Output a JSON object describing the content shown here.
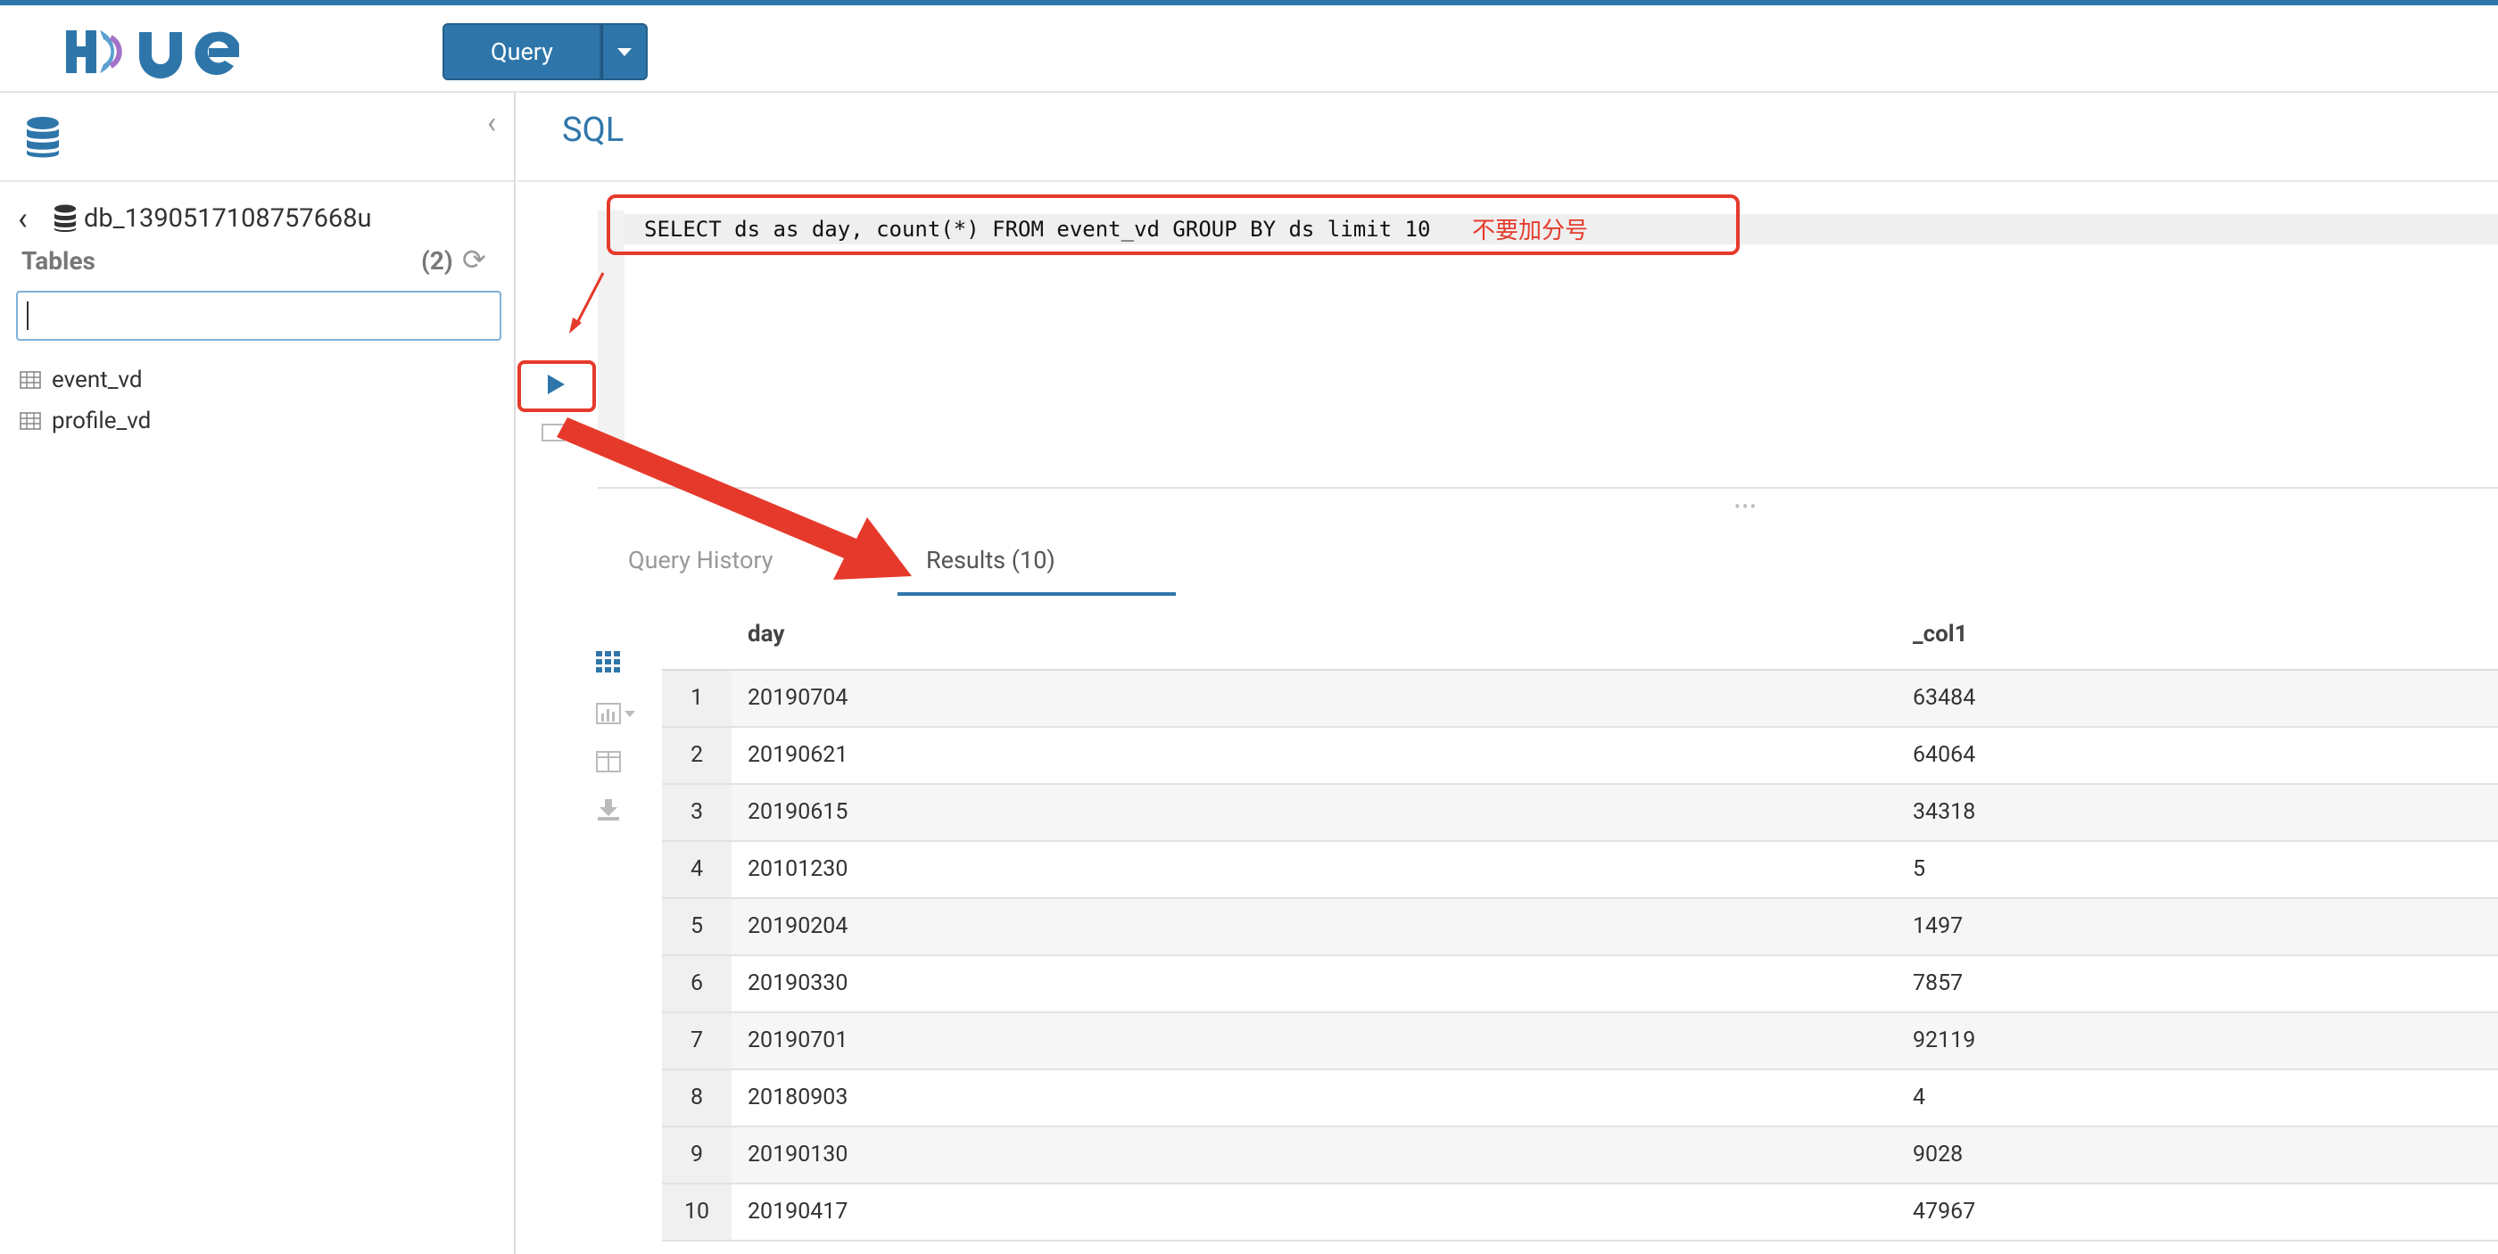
{
  "app": {
    "logo": "HUE",
    "query_button_label": "Query"
  },
  "sidebar": {
    "database_name": "db_1390517108757668u",
    "tables_label": "Tables",
    "tables_count": "(2)",
    "filter_value": "",
    "tables": [
      {
        "name": "event_vd"
      },
      {
        "name": "profile_vd"
      }
    ]
  },
  "editor": {
    "title": "SQL",
    "query": "SELECT ds as day, count(*) FROM event_vd GROUP BY ds limit 10",
    "annotation": "不要加分号"
  },
  "tabs": {
    "history": "Query History",
    "results": "Results (10)"
  },
  "results": {
    "columns": [
      "day",
      "_col1"
    ],
    "rows": [
      {
        "n": "1",
        "day": "20190704",
        "col1": "63484"
      },
      {
        "n": "2",
        "day": "20190621",
        "col1": "64064"
      },
      {
        "n": "3",
        "day": "20190615",
        "col1": "34318"
      },
      {
        "n": "4",
        "day": "20101230",
        "col1": "5"
      },
      {
        "n": "5",
        "day": "20190204",
        "col1": "1497"
      },
      {
        "n": "6",
        "day": "20190330",
        "col1": "7857"
      },
      {
        "n": "7",
        "day": "20190701",
        "col1": "92119"
      },
      {
        "n": "8",
        "day": "20180903",
        "col1": "4"
      },
      {
        "n": "9",
        "day": "20190130",
        "col1": "9028"
      },
      {
        "n": "10",
        "day": "20190417",
        "col1": "47967"
      }
    ]
  },
  "colors": {
    "accent": "#2e76aa",
    "annotation": "#e53a2b"
  }
}
